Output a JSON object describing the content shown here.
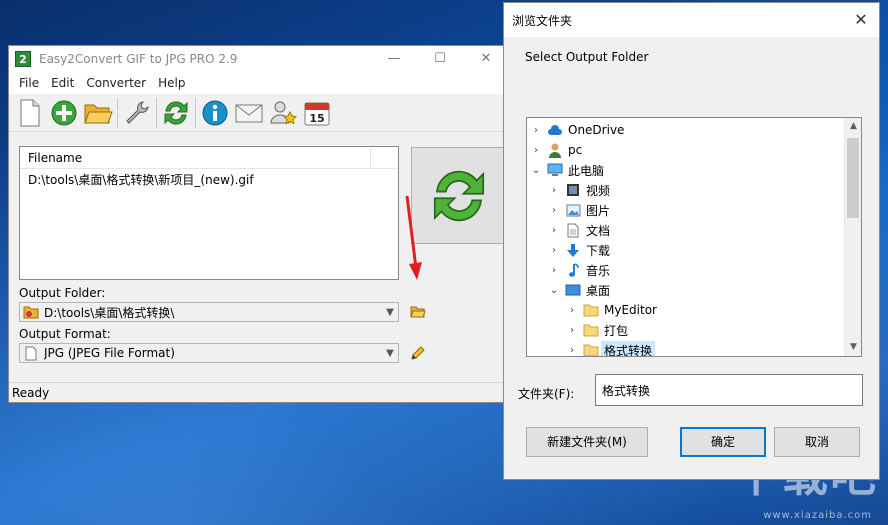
{
  "app": {
    "title": "Easy2Convert GIF to JPG PRO 2.9",
    "icon_glyph": "2",
    "window_buttons": {
      "minimize": "—",
      "maximize": "☐",
      "close": "✕"
    },
    "menu": [
      "File",
      "Edit",
      "Converter",
      "Help"
    ],
    "toolbar_icons": [
      "new-file-icon",
      "add-icon",
      "open-folder-icon",
      "settings-wrench-icon",
      "refresh-convert-icon",
      "info-icon",
      "email-icon",
      "user-star-icon",
      "calendar-icon"
    ],
    "calendar_day": "15",
    "file_list": {
      "column": "Filename",
      "rows": [
        "D:\\tools\\桌面\\格式转换\\新项目_(new).gif"
      ]
    },
    "output_folder": {
      "label": "Output Folder:",
      "value": "D:\\tools\\桌面\\格式转换\\"
    },
    "output_format": {
      "label": "Output Format:",
      "value": "JPG (JPEG File Format)"
    },
    "status": "Ready"
  },
  "dialog": {
    "title": "浏览文件夹",
    "close": "✕",
    "prompt": "Select Output Folder",
    "tree": [
      {
        "label": "OneDrive",
        "icon": "cloud-icon",
        "chevron": "›",
        "level": 0
      },
      {
        "label": "pc",
        "icon": "user-icon",
        "chevron": "›",
        "level": 0
      },
      {
        "label": "此电脑",
        "icon": "computer-icon",
        "chevron": "⌄",
        "level": 0
      },
      {
        "label": "视频",
        "icon": "video-icon",
        "chevron": "›",
        "level": 1
      },
      {
        "label": "图片",
        "icon": "picture-icon",
        "chevron": "›",
        "level": 1
      },
      {
        "label": "文档",
        "icon": "document-icon",
        "chevron": "›",
        "level": 1
      },
      {
        "label": "下载",
        "icon": "download-icon",
        "chevron": "›",
        "level": 1
      },
      {
        "label": "音乐",
        "icon": "music-icon",
        "chevron": "›",
        "level": 1
      },
      {
        "label": "桌面",
        "icon": "desktop-icon",
        "chevron": "⌄",
        "level": 1
      },
      {
        "label": "MyEditor",
        "icon": "folder-icon",
        "chevron": "›",
        "level": 2
      },
      {
        "label": "打包",
        "icon": "folder-icon",
        "chevron": "›",
        "level": 2
      },
      {
        "label": "格式转换",
        "icon": "folder-icon",
        "chevron": "›",
        "level": 2,
        "selected": true
      }
    ],
    "folder_label": "文件夹(F):",
    "folder_value": "格式转换",
    "buttons": {
      "new_folder": "新建文件夹(M)",
      "ok": "确定",
      "cancel": "取消"
    }
  },
  "watermark": {
    "logo": "下载吧",
    "site": "www.xiazaiba.com"
  },
  "colors": {
    "accent": "#0078d7",
    "selection": "#cce8ff",
    "annotation_arrow": "#e02020",
    "convert_green": "#3aa43a"
  }
}
